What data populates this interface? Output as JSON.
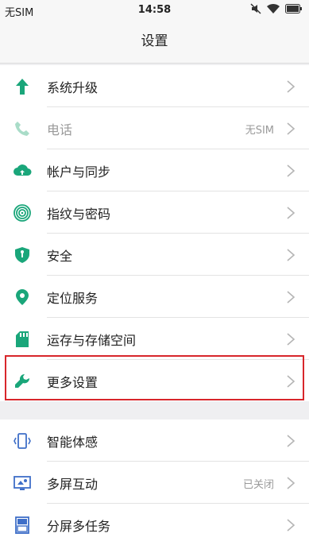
{
  "status_bar": {
    "carrier": "无SIM",
    "time": "14:58",
    "icons": [
      "mute-icon",
      "wifi-icon",
      "battery-icon"
    ]
  },
  "header": {
    "title": "设置"
  },
  "group1": [
    {
      "label": "系统升级",
      "icon": "arrow-up-icon",
      "enabled": true
    },
    {
      "label": "电话",
      "icon": "phone-icon",
      "value": "无SIM",
      "enabled": false
    },
    {
      "label": "帐户与同步",
      "icon": "cloud-sync-icon",
      "enabled": true
    },
    {
      "label": "指纹与密码",
      "icon": "fingerprint-icon",
      "enabled": true
    },
    {
      "label": "安全",
      "icon": "shield-icon",
      "enabled": true
    },
    {
      "label": "定位服务",
      "icon": "location-pin-icon",
      "enabled": true
    },
    {
      "label": "运存与存储空间",
      "icon": "sd-card-icon",
      "enabled": true
    },
    {
      "label": "更多设置",
      "icon": "wrench-icon",
      "enabled": true,
      "highlighted": true
    }
  ],
  "group2": [
    {
      "label": "智能体感",
      "icon": "motion-gesture-icon"
    },
    {
      "label": "多屏互动",
      "icon": "screen-cast-icon",
      "value": "已关闭"
    },
    {
      "label": "分屏多任务",
      "icon": "split-screen-icon"
    }
  ],
  "colors": {
    "green_accent": "#1aa67a",
    "blue_accent": "#3f6fc8",
    "highlight_border": "#d8262b"
  }
}
